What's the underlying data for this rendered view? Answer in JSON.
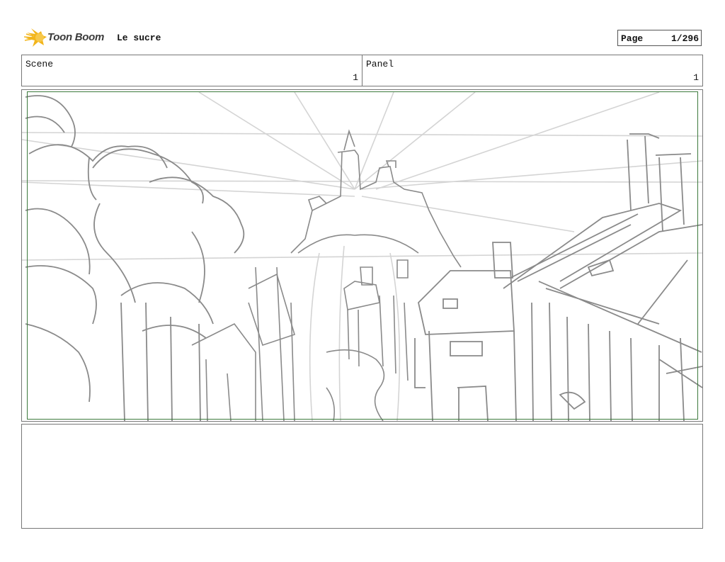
{
  "header": {
    "logo_text": "Toon Boom",
    "project_title": "Le sucre",
    "page_label": "Page",
    "page_value": "1/296"
  },
  "info": {
    "scene_label": "Scene",
    "scene_value": "1",
    "panel_label": "Panel",
    "panel_value": "1"
  },
  "colors": {
    "safe_frame": "#3d7a3d",
    "sketch_stroke": "#8a8a8a",
    "guide_stroke": "#d0d0d0",
    "logo_accent": "#f2b51b"
  },
  "panel": {
    "image": "pencil sketch of a village street with houses and a castle on a hill"
  }
}
